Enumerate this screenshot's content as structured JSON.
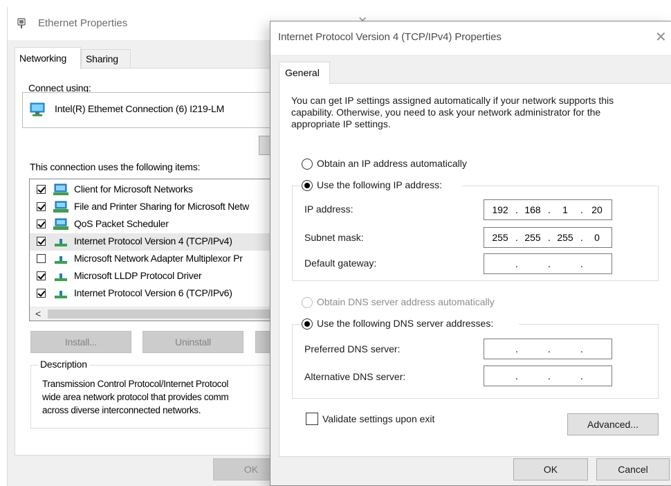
{
  "ethernet": {
    "title": "Ethernet Properties",
    "close": "✕",
    "tabs": [
      "Networking",
      "Sharing"
    ],
    "connect_using_label": "Connect using:",
    "adapter_name": "Intel(R) Ethemet Connection (6) I219-LM",
    "items_label": "This connection uses the following items:",
    "items": [
      {
        "label": "Client for Microsoft Networks",
        "checked": true,
        "icon": "network-client-icon"
      },
      {
        "label": "File and Printer Sharing for Microsoft Netw",
        "checked": true,
        "icon": "network-service-icon"
      },
      {
        "label": "QoS Packet Scheduler",
        "checked": true,
        "icon": "network-service-icon"
      },
      {
        "label": "Internet Protocol Version 4 (TCP/IPv4)",
        "checked": true,
        "icon": "protocol-icon"
      },
      {
        "label": "Microsoft Network Adapter Multiplexor Pr",
        "checked": false,
        "icon": "protocol-icon"
      },
      {
        "label": "Microsoft LLDP Protocol Driver",
        "checked": true,
        "icon": "protocol-icon"
      },
      {
        "label": "Internet Protocol Version 6 (TCP/IPv6)",
        "checked": true,
        "icon": "protocol-icon"
      }
    ],
    "install_label": "Install...",
    "uninstall_label": "Uninstall",
    "description_label": "Description",
    "description_text": "Transmission Control Protocol/Internet Protocol\nwide area network protocol that provides comm\nacross diverse interconnected networks.",
    "ok_label": "OK"
  },
  "ipv4": {
    "title": "Internet Protocol Version 4 (TCP/IPv4) Properties",
    "close": "✕",
    "tab": "General",
    "intro": "You can get IP settings assigned automatically if your network supports this capability. Otherwise, you need to ask your network administrator for the appropriate IP settings.",
    "obtain_ip_auto": "Obtain an IP address automatically",
    "use_following_ip": "Use the following IP address:",
    "ip_address_label": "IP address:",
    "ip_address": [
      "192",
      "168",
      "1",
      "20"
    ],
    "subnet_label": "Subnet mask:",
    "subnet_mask": [
      "255",
      "255",
      "255",
      "0"
    ],
    "gateway_label": "Default gateway:",
    "gateway": [
      "",
      "",
      "",
      ""
    ],
    "obtain_dns_auto": "Obtain DNS server address automatically",
    "use_following_dns": "Use the following DNS server addresses:",
    "preferred_dns_label": "Preferred DNS server:",
    "preferred_dns": [
      "",
      "",
      "",
      ""
    ],
    "alternate_dns_label": "Alternative DNS server:",
    "alternate_dns": [
      "",
      "",
      "",
      ""
    ],
    "validate_label": "Validate settings upon exit",
    "advanced_label": "Advanced...",
    "ok_label": "OK",
    "cancel_label": "Cancel"
  }
}
